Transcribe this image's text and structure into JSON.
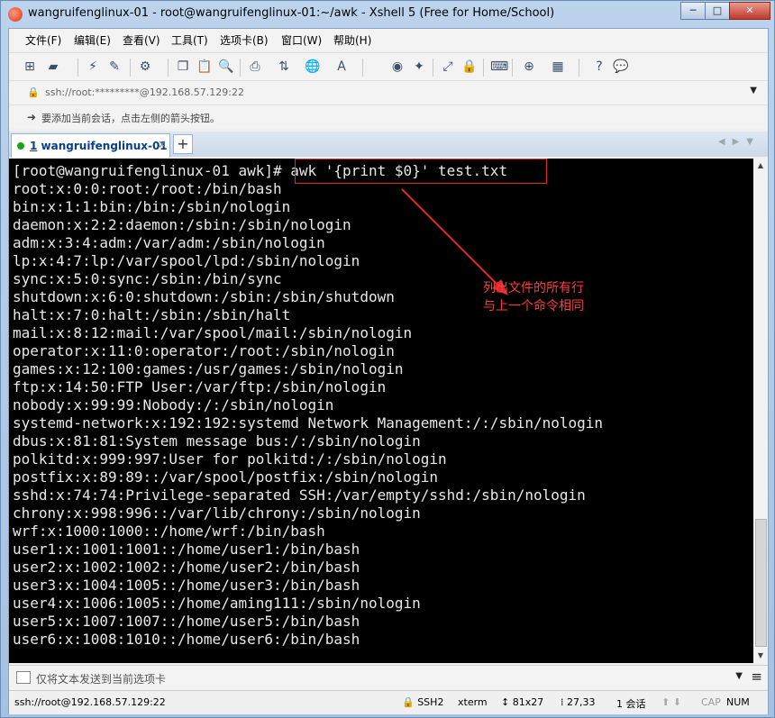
{
  "window": {
    "title": "wangruifenglinux-01 - root@wangruifenglinux-01:~/awk - Xshell 5 (Free for Home/School)",
    "minimize": "─",
    "maximize": "□",
    "close": "✕"
  },
  "menu": {
    "items": [
      "文件(F)",
      "编辑(E)",
      "查看(V)",
      "工具(T)",
      "选项卡(B)",
      "窗口(W)",
      "帮助(H)"
    ]
  },
  "address": {
    "value": "ssh://root:*********@192.168.57.129:22"
  },
  "hint": {
    "text": "要添加当前会话，点击左侧的箭头按钮。"
  },
  "tabs": {
    "active_number": "1",
    "active_label": " wangruifenglinux-01",
    "close": "×",
    "add": "+"
  },
  "terminal": {
    "prompt": "[root@wangruifenglinux-01 awk]# ",
    "command": "awk '{print $0}' test.txt",
    "lines": [
      "root:x:0:0:root:/root:/bin/bash",
      "bin:x:1:1:bin:/bin:/sbin/nologin",
      "daemon:x:2:2:daemon:/sbin:/sbin/nologin",
      "adm:x:3:4:adm:/var/adm:/sbin/nologin",
      "lp:x:4:7:lp:/var/spool/lpd:/sbin/nologin",
      "sync:x:5:0:sync:/sbin:/bin/sync",
      "shutdown:x:6:0:shutdown:/sbin:/sbin/shutdown",
      "halt:x:7:0:halt:/sbin:/sbin/halt",
      "mail:x:8:12:mail:/var/spool/mail:/sbin/nologin",
      "operator:x:11:0:operator:/root:/sbin/nologin",
      "games:x:12:100:games:/usr/games:/sbin/nologin",
      "ftp:x:14:50:FTP User:/var/ftp:/sbin/nologin",
      "nobody:x:99:99:Nobody:/:/sbin/nologin",
      "systemd-network:x:192:192:systemd Network Management:/:/sbin/nologin",
      "dbus:x:81:81:System message bus:/:/sbin/nologin",
      "polkitd:x:999:997:User for polkitd:/:/sbin/nologin",
      "postfix:x:89:89::/var/spool/postfix:/sbin/nologin",
      "sshd:x:74:74:Privilege-separated SSH:/var/empty/sshd:/sbin/nologin",
      "chrony:x:998:996::/var/lib/chrony:/sbin/nologin",
      "wrf:x:1000:1000::/home/wrf:/bin/bash",
      "user1:x:1001:1001::/home/user1:/bin/bash",
      "user2:x:1002:1002::/home/user2:/bin/bash",
      "user3:x:1004:1005::/home/user3:/bin/bash",
      "user4:x:1006:1005::/home/aming111:/sbin/nologin",
      "user5:x:1007:1007::/home/user5:/bin/bash",
      "user6:x:1008:1010::/home/user6:/bin/bash"
    ],
    "annotation_line1": "列出文件的所有行",
    "annotation_line2": "与上一个命令相同",
    "annotation_color": "#e02a2a"
  },
  "sendbar": {
    "placeholder": "仅将文本发送到当前选项卡"
  },
  "status": {
    "connection": "ssh://root@192.168.57.129:22",
    "protocol": "SSH2",
    "terminal_type": "xterm",
    "size": "81x27",
    "cursor": "27,33",
    "sessions": "1 会话",
    "cap": "CAP",
    "num": "NUM"
  }
}
